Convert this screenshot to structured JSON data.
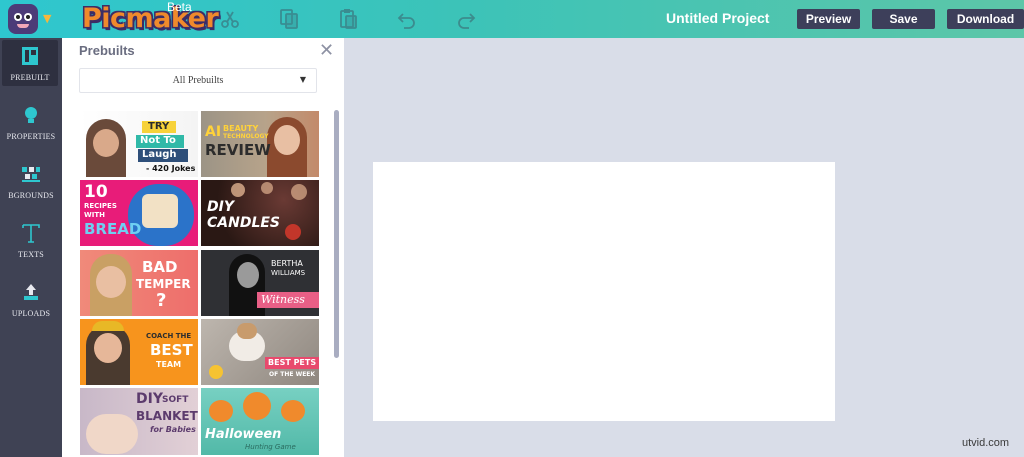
{
  "app": {
    "logo": "Picmaker",
    "badge": "Beta"
  },
  "header": {
    "project_title": "Untitled Project",
    "buttons": {
      "preview": "Preview",
      "save": "Save",
      "download": "Download"
    }
  },
  "sidebar": {
    "items": [
      {
        "label": "PREBUILT",
        "icon": "layout-icon",
        "active": true
      },
      {
        "label": "PROPERTIES",
        "icon": "bulb-icon"
      },
      {
        "label": "BGROUNDS",
        "icon": "pattern-icon"
      },
      {
        "label": "TEXTS",
        "icon": "text-icon"
      },
      {
        "label": "UPLOADS",
        "icon": "upload-icon"
      }
    ]
  },
  "panel": {
    "title": "Prebuilts",
    "filter": {
      "selected": "All Prebuilts"
    },
    "templates": [
      {
        "text": [
          "TRY",
          "Not To",
          "Laugh",
          "- 420 Jokes"
        ]
      },
      {
        "text": [
          "AI",
          "BEAUTY",
          "TECHNOLOGY",
          "REVIEW"
        ]
      },
      {
        "text": [
          "10",
          "RECIPES",
          "WITH",
          "BREAD"
        ]
      },
      {
        "text": [
          "DIY",
          "CANDLES"
        ]
      },
      {
        "text": [
          "BAD",
          "TEMPER",
          "?"
        ]
      },
      {
        "text": [
          "BERTHA",
          "WILLIAMS",
          "Witness"
        ]
      },
      {
        "text": [
          "COACH THE",
          "BEST",
          "TEAM"
        ]
      },
      {
        "text": [
          "BEST PETS",
          "OF THE WEEK"
        ]
      },
      {
        "text": [
          "DIY",
          "SOFT",
          "BLANKET",
          "for Babies"
        ]
      },
      {
        "text": [
          "Halloween",
          "Hunting Game"
        ]
      }
    ]
  },
  "watermark": "utvid.com",
  "colors": {
    "accent": "#2ec7cf",
    "rail": "#3f4254",
    "button": "#3d3f5a",
    "workspace": "#d9dde8"
  }
}
